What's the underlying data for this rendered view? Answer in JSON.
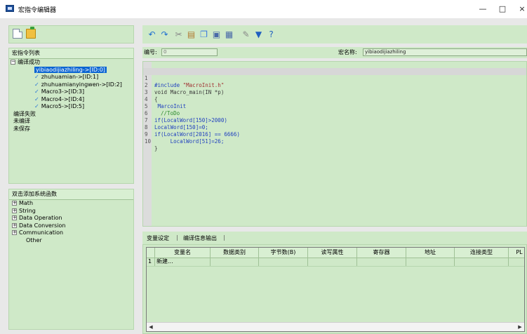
{
  "window": {
    "title": "宏指令编辑器",
    "min": "—",
    "max": "□",
    "close": "×"
  },
  "left": {
    "macro_list_header": "宏指令列表",
    "tree": [
      {
        "label": "编译成功",
        "expander": "⊟",
        "level": 0
      },
      {
        "label": "yibiaodijiazhiling->[ID:0]",
        "level": 2,
        "selected": true
      },
      {
        "label": "zhuhuamian->[ID:1]",
        "level": 2,
        "check": "✓"
      },
      {
        "label": "zhuhuamianyingwen->[ID:2]",
        "level": 2,
        "check": "✓"
      },
      {
        "label": "Macro3->[ID:3]",
        "level": 2,
        "check": "✓"
      },
      {
        "label": "Macro4->[ID:4]",
        "level": 2,
        "check": "✓"
      },
      {
        "label": "Macro5->[ID:5]",
        "level": 2,
        "check": "✓"
      },
      {
        "label": "编译失败",
        "level": 0
      },
      {
        "label": "未编译",
        "level": 0
      },
      {
        "label": "未保存",
        "level": 0
      }
    ],
    "func_header": "双击添加系统函数",
    "funcs": [
      {
        "label": "Math",
        "expander": "⊞"
      },
      {
        "label": "String",
        "expander": "⊞"
      },
      {
        "label": "Data Operation",
        "expander": "⊞"
      },
      {
        "label": "Data Conversion",
        "expander": "⊞"
      },
      {
        "label": "Communication",
        "expander": "⊞"
      },
      {
        "label": "Other",
        "expander": ""
      }
    ]
  },
  "fields": {
    "id_label": "编号:",
    "id_value": "0",
    "name_label": "宏名称:",
    "name_value": "yibiaodijiazhiling"
  },
  "code": [
    {
      "ln": "1",
      "text": "#include \"MacroInit.h\""
    },
    {
      "ln": "2",
      "text": "void Macro_main(IN *p)"
    },
    {
      "ln": "3",
      "text": "{"
    },
    {
      "ln": "4",
      "text": " MarcoInit"
    },
    {
      "ln": "5",
      "text": "  //ToDo"
    },
    {
      "ln": "6",
      "text": "if(LocalWord[150]>2000)"
    },
    {
      "ln": "7",
      "text": "LocalWord[150]=0;"
    },
    {
      "ln": "8",
      "text": "if(LocalWord[2016] == 6666)"
    },
    {
      "ln": "9",
      "text": "     LocalWord[51]=26;"
    },
    {
      "ln": "10",
      "text": "}"
    }
  ],
  "tabs": {
    "var_settings": "变量设定",
    "sep1": "|",
    "compile_output": "编译信息输出",
    "sep2": "|"
  },
  "table": {
    "columns": [
      "变量名",
      "数据类别",
      "字节数(B)",
      "读写属性",
      "寄存器",
      "地址",
      "连接类型",
      "PL"
    ],
    "row": {
      "num": "1",
      "name": "新建..."
    }
  },
  "colors": {
    "panel_bg": "#cfe9c8",
    "selection": "#0a64d2",
    "keyword": "#1f3fbf",
    "string": "#a03030",
    "comment": "#2a8a2a"
  }
}
